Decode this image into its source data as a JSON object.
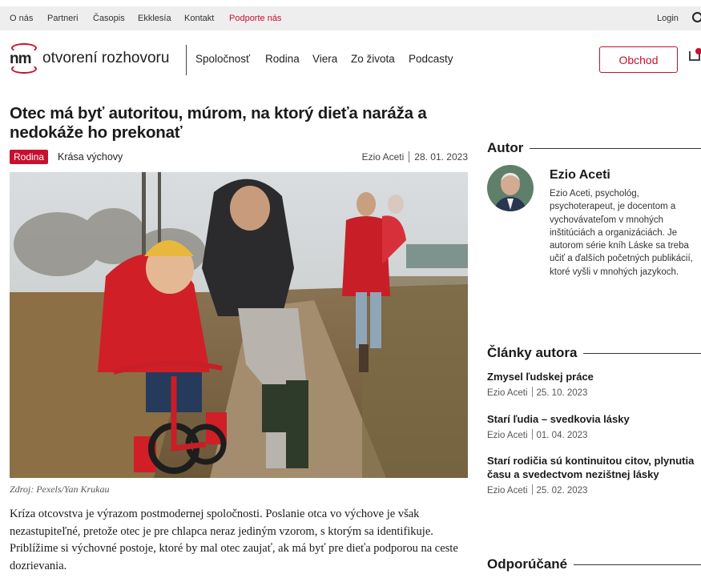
{
  "topbar": {
    "links": [
      "O nás",
      "Partneri",
      "Časopis",
      "Ekklesía",
      "Kontakt"
    ],
    "support": "Podporte nás",
    "login": "Login"
  },
  "brand": {
    "mark": "nm",
    "name": "otvorení rozhovoru"
  },
  "nav": [
    "Spoločnosť",
    "Rodina",
    "Viera",
    "Zo života",
    "Podcasty"
  ],
  "shop_button": "Obchod",
  "colors": {
    "accent": "#c8102e",
    "topbar_bg": "#eeeeee"
  },
  "icons": {
    "search": "search-icon",
    "cart": "cart-icon"
  },
  "article": {
    "title": "Otec má byť autoritou, múrom, na ktorý dieťa naráža a nedokáže ho prekonať",
    "tag": "Rodina",
    "subcategory": "Krása výchovy",
    "author": "Ezio Aceti",
    "date": "28. 01. 2023",
    "photo_caption": "Zdroj: Pexels/Yan Krukau",
    "lead": "Kríza otcovstva je výrazom postmodernej spoločnosti. Poslanie otca vo výchove je však nezastupiteľné, pretože otec je pre chlapca neraz jediným vzorom, s ktorým sa identifikuje. Priblížime si výchovné postoje, ktoré by mal otec zaujať, ak má byť pre dieťa podporou na ceste dozrievania."
  },
  "sidebar": {
    "author_heading": "Autor",
    "author_name": "Ezio Aceti",
    "author_bio": "Ezio Aceti, psychológ, psychoterapeut, je docentom a vychovávateľom v mnohých inštitúciách a organizáciách. Je autorom série kníh Láske sa treba učiť a ďalších početných publikácií, ktoré vyšli v mnohých jazykoch.",
    "articles_heading": "Články autora",
    "articles": [
      {
        "title": "Zmysel ľudskej práce",
        "author": "Ezio Aceti",
        "date": "25. 10. 2023"
      },
      {
        "title": "Starí ľudia – svedkovia lásky",
        "author": "Ezio Aceti",
        "date": "01. 04. 2023"
      },
      {
        "title": "Starí rodičia sú kontinuitou citov, plynutia času a svedectvom nezištnej lásky",
        "author": "Ezio Aceti",
        "date": "25. 02. 2023"
      }
    ],
    "recommended_heading": "Odporúčané"
  }
}
